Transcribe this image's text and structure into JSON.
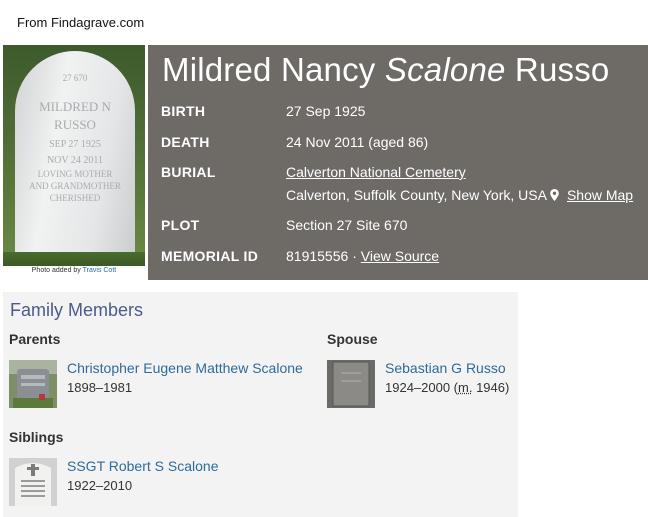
{
  "source": "From Findagrave.com",
  "photo": {
    "stone_number": "27 670",
    "stone_name_line1": "Mildred N",
    "stone_name_line2": "Russo",
    "stone_birth": "Sep 27 1925",
    "stone_death": "Nov 24 2011",
    "stone_epitaph_line1": "Loving mother",
    "stone_epitaph_line2": "and grandmother",
    "stone_epitaph_line3": "Cherished",
    "credit_prefix": "Photo added by",
    "credit_name": "Travis Cott"
  },
  "memorial": {
    "name_first": "Mildred Nancy",
    "name_maiden": "Scalone",
    "name_last": "Russo",
    "birth_label": "BIRTH",
    "birth_value": "27 Sep 1925",
    "death_label": "DEATH",
    "death_value": "24 Nov 2011 (aged 86)",
    "burial_label": "BURIAL",
    "burial_cemetery": "Calverton National Cemetery",
    "burial_location": "Calverton, Suffolk County, New York, USA",
    "show_map": "Show Map",
    "plot_label": "PLOT",
    "plot_value": "Section 27 Site 670",
    "id_label": "MEMORIAL ID",
    "id_value": "81915556",
    "id_separator": "·",
    "view_source": "View Source"
  },
  "family": {
    "title": "Family Members",
    "parents_title": "Parents",
    "spouse_title": "Spouse",
    "siblings_title": "Siblings",
    "parent": {
      "name": "Christopher Eugene Matthew Scalone",
      "dates": "1898–1981"
    },
    "spouse": {
      "name": "Sebastian G Russo",
      "dates_prefix": "1924–2000 (",
      "married_abbr": "m.",
      "dates_suffix": " 1946)"
    },
    "sibling": {
      "name": "SSGT Robert S Scalone",
      "dates": "1922–2010"
    }
  },
  "colors": {
    "panel_bg": "#6e6b67",
    "family_bg": "#f3f3f3",
    "family_title": "#4a5b8c",
    "link_blue": "#2f6a9c"
  }
}
